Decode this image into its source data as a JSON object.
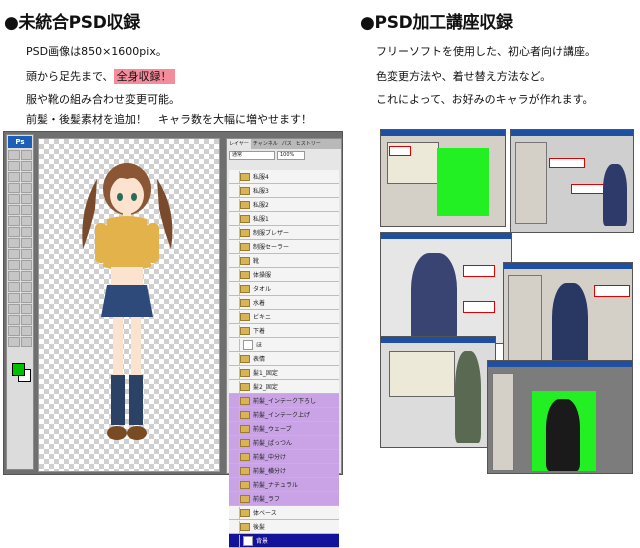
{
  "left_section": {
    "heading": "●未統合PSD収録",
    "lines": [
      "PSD画像は850×1600pix。",
      "頭から足先まで、",
      "服や靴の組み合わせ変更可能。",
      "前髪・後髪素材を追加！　キャラ数を大幅に増やせます！"
    ],
    "highlight": "全身収録！"
  },
  "right_section": {
    "heading": "●PSD加工講座収録",
    "lines": [
      "フリーソフトを使用した、初心者向け講座。",
      "色変更方法や、着せ替え方法など。",
      "これによって、お好みのキャラが作れます。"
    ]
  },
  "photoshop": {
    "app_badge": "Ps",
    "panel_tabs": [
      "レイヤー",
      "チャンネル",
      "パス",
      "ヒストリー"
    ],
    "blend_mode": "通常",
    "opacity": "100%",
    "layers": [
      {
        "name": "私服4",
        "type": "folder",
        "style": "normal"
      },
      {
        "name": "私服3",
        "type": "folder",
        "style": "normal"
      },
      {
        "name": "私服2",
        "type": "folder",
        "style": "normal"
      },
      {
        "name": "私服1",
        "type": "folder",
        "style": "normal"
      },
      {
        "name": "制服ブレザー",
        "type": "folder",
        "style": "normal"
      },
      {
        "name": "制服セーラー",
        "type": "folder",
        "style": "normal"
      },
      {
        "name": "靴",
        "type": "folder",
        "style": "normal"
      },
      {
        "name": "体操服",
        "type": "folder",
        "style": "normal"
      },
      {
        "name": "タオル",
        "type": "folder",
        "style": "normal"
      },
      {
        "name": "水着",
        "type": "folder",
        "style": "normal"
      },
      {
        "name": "ビキニ",
        "type": "folder",
        "style": "normal"
      },
      {
        "name": "下着",
        "type": "folder",
        "style": "normal"
      },
      {
        "name": "ほ",
        "type": "layer",
        "style": "normal"
      },
      {
        "name": "表情",
        "type": "folder",
        "style": "normal"
      },
      {
        "name": "髪1_固定",
        "type": "folder",
        "style": "normal"
      },
      {
        "name": "髪2_固定",
        "type": "folder",
        "style": "normal"
      },
      {
        "name": "前髪_インテーク下ろし",
        "type": "folder",
        "style": "purple"
      },
      {
        "name": "前髪_インテーク上げ",
        "type": "folder",
        "style": "purple"
      },
      {
        "name": "前髪_ウェーブ",
        "type": "folder",
        "style": "purple"
      },
      {
        "name": "前髪_ぱっつん",
        "type": "folder",
        "style": "purple"
      },
      {
        "name": "前髪_中分け",
        "type": "folder",
        "style": "purple"
      },
      {
        "name": "前髪_横分け",
        "type": "folder",
        "style": "purple"
      },
      {
        "name": "前髪_ナチュラル",
        "type": "folder",
        "style": "purple"
      },
      {
        "name": "前髪_ラフ",
        "type": "folder",
        "style": "purple"
      },
      {
        "name": "体ベース",
        "type": "folder",
        "style": "normal"
      },
      {
        "name": "後髪",
        "type": "folder",
        "style": "normal"
      },
      {
        "name": "背景",
        "type": "layer",
        "style": "selected"
      }
    ]
  }
}
